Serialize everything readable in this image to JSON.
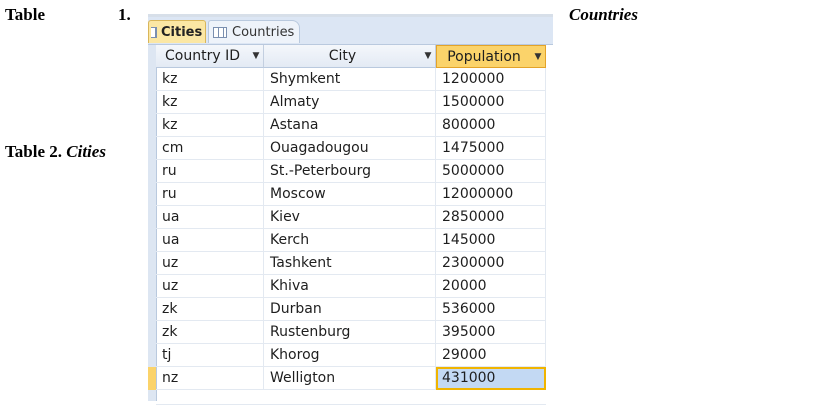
{
  "captions": {
    "table1_word": "Table",
    "table1_num": "1.",
    "table1_name": "Countries",
    "table2_prefix": "Table 2.",
    "table2_name": "Cities"
  },
  "tabs": [
    {
      "label": "Cities",
      "active": true
    },
    {
      "label": "Countries",
      "active": false
    }
  ],
  "columns": [
    {
      "label": "Country ID"
    },
    {
      "label": "City"
    },
    {
      "label": "Population"
    }
  ],
  "rows": [
    {
      "country_id": "kz",
      "city": "Shymkent",
      "population": "1200000"
    },
    {
      "country_id": "kz",
      "city": "Almaty",
      "population": "1500000"
    },
    {
      "country_id": "kz",
      "city": "Astana",
      "population": "800000"
    },
    {
      "country_id": "cm",
      "city": "Ouagadougou",
      "population": "1475000"
    },
    {
      "country_id": "ru",
      "city": "St.-Peterbourg",
      "population": "5000000"
    },
    {
      "country_id": "ru",
      "city": "Moscow",
      "population": "12000000"
    },
    {
      "country_id": "ua",
      "city": "Kiev",
      "population": "2850000"
    },
    {
      "country_id": "ua",
      "city": "Kerch",
      "population": "145000"
    },
    {
      "country_id": "uz",
      "city": "Tashkent",
      "population": "2300000"
    },
    {
      "country_id": "uz",
      "city": "Khiva",
      "population": "20000"
    },
    {
      "country_id": "zk",
      "city": "Durban",
      "population": "536000"
    },
    {
      "country_id": "zk",
      "city": "Rustenburg",
      "population": "395000"
    },
    {
      "country_id": "tj",
      "city": "Khorog",
      "population": "29000"
    },
    {
      "country_id": "nz",
      "city": "Welligton",
      "population": "431000"
    }
  ],
  "icons": {
    "tab_icon": "table-icon",
    "dropdown": "chevron-down-icon"
  },
  "colors": {
    "active_tab": "#fbe7a4",
    "sorted_header": "#fbd36a",
    "selected_cell": "#c3d9f3"
  }
}
